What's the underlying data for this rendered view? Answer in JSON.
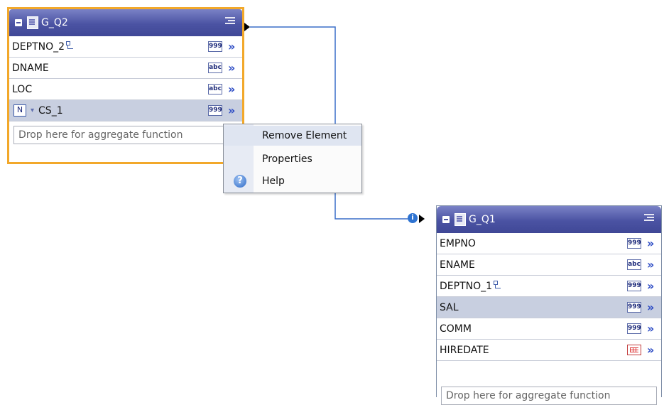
{
  "groups": {
    "g_q2": {
      "name": "G_Q2",
      "rows": [
        {
          "label": "DEPTNO_2",
          "type": "999",
          "join": true
        },
        {
          "label": "DNAME",
          "type": "abc"
        },
        {
          "label": "LOC",
          "type": "abc"
        },
        {
          "label": "CS_1",
          "type": "999",
          "badge": "N",
          "selected": true
        }
      ],
      "drop_hint": "Drop here for aggregate function"
    },
    "g_q1": {
      "name": "G_Q1",
      "rows": [
        {
          "label": "EMPNO",
          "type": "999"
        },
        {
          "label": "ENAME",
          "type": "abc"
        },
        {
          "label": "DEPTNO_1",
          "type": "999",
          "join": true
        },
        {
          "label": "SAL",
          "type": "999",
          "selected": true
        },
        {
          "label": "COMM",
          "type": "999"
        },
        {
          "label": "HIREDATE",
          "type": "date"
        }
      ],
      "drop_hint": "Drop here for aggregate function"
    }
  },
  "context_menu": {
    "items": [
      "Remove Element",
      "Properties",
      "Help"
    ]
  },
  "colors": {
    "selection_border": "#f2a82a",
    "header": "#4b53a3",
    "link": "#3a6fc8"
  }
}
